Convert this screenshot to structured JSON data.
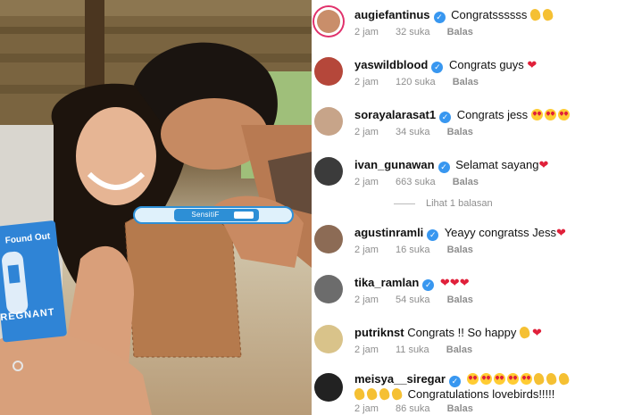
{
  "photo": {
    "test_label": "SensitiF",
    "box_top": "Found Out",
    "box_bottom": "REGNANT"
  },
  "comments": [
    {
      "username": "augiefantinus",
      "verified": true,
      "text": "Congratssssss",
      "emoji": [
        "clap",
        "clap"
      ],
      "time": "2 jam",
      "likes": "32 suka",
      "reply": "Balas",
      "avatar_color": "#c98e6a"
    },
    {
      "username": "yaswildblood",
      "verified": true,
      "text": "Congrats guys",
      "emoji": [
        "heart"
      ],
      "time": "2 jam",
      "likes": "120 suka",
      "reply": "Balas",
      "avatar_color": "#b5473a"
    },
    {
      "username": "sorayalarasat1",
      "verified": true,
      "text": "Congrats jess",
      "emoji": [
        "heart-eyes",
        "heart-eyes",
        "heart-eyes"
      ],
      "time": "2 jam",
      "likes": "34 suka",
      "reply": "Balas",
      "avatar_color": "#c7a489"
    },
    {
      "username": "ivan_gunawan",
      "verified": true,
      "text": "Selamat sayang",
      "emoji": [
        "heart"
      ],
      "time": "2 jam",
      "likes": "663 suka",
      "reply": "Balas",
      "avatar_color": "#3b3b3b"
    },
    {
      "username": "agustinramli",
      "verified": true,
      "text": "Yeayy congratss Jess",
      "emoji": [
        "heart"
      ],
      "time": "2 jam",
      "likes": "16 suka",
      "reply": "Balas",
      "avatar_color": "#8c6b55"
    },
    {
      "username": "tika_ramlan",
      "verified": true,
      "text": "",
      "emoji": [
        "heart",
        "heart",
        "heart"
      ],
      "time": "2 jam",
      "likes": "54 suka",
      "reply": "Balas",
      "avatar_color": "#6c6c6c"
    },
    {
      "username": "putriknst",
      "verified": false,
      "text": "Congrats !! So happy",
      "emoji": [
        "clap",
        "heart"
      ],
      "time": "2 jam",
      "likes": "11 suka",
      "reply": "Balas",
      "avatar_color": "#d9c38a"
    },
    {
      "username": "meisya__siregar",
      "verified": true,
      "text": "Congratulations lovebirds!!!!!",
      "emoji": [
        "heart-eyes",
        "heart-eyes",
        "heart-eyes",
        "heart-eyes",
        "heart-eyes",
        "clap",
        "clap",
        "clap"
      ],
      "emoji_after": [
        "clap",
        "clap",
        "clap",
        "clap"
      ],
      "time": "2 jam",
      "likes": "86 suka",
      "reply": "Balas",
      "avatar_color": "#222222"
    }
  ],
  "view_replies": "Lihat 1 balasan"
}
